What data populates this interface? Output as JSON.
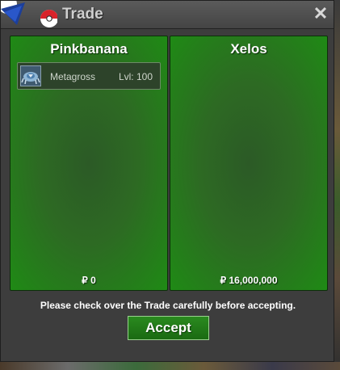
{
  "window": {
    "title": "Trade",
    "close_symbol": "✕",
    "title_icon": "pokeball-emblem-icon"
  },
  "trade": {
    "left": {
      "player": "Pinkbanana",
      "items": [
        {
          "name": "Metagross",
          "level": "Lvl: 100",
          "icon": "metagross-icon"
        }
      ],
      "money": "₽ 0"
    },
    "right": {
      "player": "Xelos",
      "items": [],
      "money": "₽ 16,000,000"
    }
  },
  "footer": {
    "notice": "Please check over the Trade carefully before accepting.",
    "accept_label": "Accept"
  },
  "colors": {
    "panel_green": "#2d6a23",
    "accept_green": "#1a6a12"
  }
}
